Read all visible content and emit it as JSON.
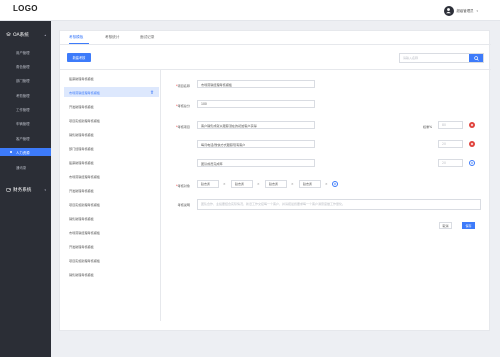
{
  "header": {
    "logo": "LOGO",
    "user_name": "超级管理员",
    "caret": "▾"
  },
  "sidebar": {
    "groups": [
      {
        "label": "OA系统",
        "icon": "layers-icon",
        "chevron": "▴"
      },
      {
        "label": "财务系统",
        "icon": "wallet-icon",
        "chevron": "▾"
      }
    ],
    "items": [
      {
        "label": "用户管理"
      },
      {
        "label": "角色管理"
      },
      {
        "label": "部门管理"
      },
      {
        "label": "考勤管理"
      },
      {
        "label": "工作管理"
      },
      {
        "label": "车辆管理"
      },
      {
        "label": "客户管理"
      },
      {
        "label": "人力资源"
      },
      {
        "label": "通讯录"
      }
    ],
    "active_item": "人力资源"
  },
  "tabs": [
    {
      "label": "考核模板",
      "active": true
    },
    {
      "label": "考核统计",
      "active": false
    },
    {
      "label": "面试记录",
      "active": false
    }
  ],
  "toolbar": {
    "new_label": "新建考核",
    "search_placeholder": "请输入名称"
  },
  "template_list": [
    "股票助理考核模板",
    "市场营销经理考核模板",
    "开发助理考核模板",
    "项目实施助理考核模板",
    "销售助理考核模板",
    "部门经理考核模板",
    "股票助理考核模板",
    "市场营销经理考核模板",
    "开发助理考核模板",
    "项目实施助理考核模板",
    "销售助理考核模板",
    "市场营销经理考核模板",
    "开发助理考核模板",
    "项目实施助理考核模板",
    "销售助理考核模板"
  ],
  "selected_index": 1,
  "form": {
    "name_label": "项目名称",
    "name_value": "市场营销经理考核模板",
    "score_label": "考核总分",
    "score_value": "100",
    "items_label": "考核项目",
    "weight_label": "权重%",
    "items": [
      {
        "text": "客户销售成就以跟踪潜在的初始客户获得",
        "weight_placeholder": "80",
        "action": "remove"
      },
      {
        "text": "每月电话/微信方式跟踪现有客户",
        "weight_placeholder": "20",
        "action": "remove"
      },
      {
        "text": "团队成员完成率",
        "weight_placeholder": "20",
        "action": "add"
      }
    ],
    "target_label": "考核对象",
    "targets": [
      "赵志勇",
      "赵志勇",
      "赵志勇",
      "赵志勇"
    ],
    "tag_remove": "×",
    "desc_label": "考核说明",
    "desc_placeholder": "团队合作，业绩要结合实际情况，新旧工作交接每一个客户，并请把最终要求每一个客户满意度做工作量化。",
    "cancel_label": "取消",
    "save_label": "保存"
  },
  "colors": {
    "accent": "#3d7bfa",
    "sidebar_bg": "#2b2e36",
    "danger": "#e0403a"
  }
}
